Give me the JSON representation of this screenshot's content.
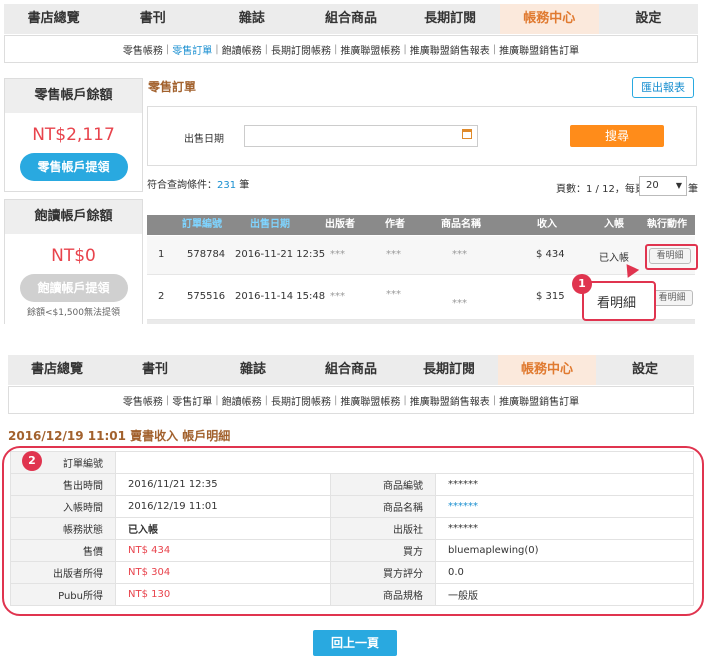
{
  "nav": [
    "書店總覽",
    "書刊",
    "雜誌",
    "組合商品",
    "長期訂閱",
    "帳務中心",
    "設定"
  ],
  "subnav": [
    "零售帳務",
    "零售訂單",
    "飽讀帳務",
    "長期訂閱帳務",
    "推廣聯盟帳務",
    "推廣聯盟銷售報表",
    "推廣聯盟銷售訂單"
  ],
  "retail_box": {
    "title": "零售帳戶餘額",
    "amount": "NT$2,117",
    "button": "零售帳戶提領"
  },
  "bao_box": {
    "title": "飽讀帳戶餘額",
    "amount": "NT$0",
    "button": "飽讀帳戶提領",
    "note": "餘額<$1,500無法提領"
  },
  "orders": {
    "title": "零售訂單",
    "export_button": "匯出報表",
    "date_label": "出售日期",
    "search_button": "搜尋",
    "match_prefix": "符合查詢條件：",
    "match_count": "231",
    "match_suffix": "筆",
    "page_info": "頁數：1 / 12，每頁",
    "per_page": "20",
    "per_page_suffix": "筆",
    "columns": [
      "訂單編號",
      "出售日期",
      "出版者",
      "作者",
      "商品名稱",
      "收入",
      "入帳",
      "執行動作"
    ],
    "rows": [
      {
        "no": "1",
        "order": "578784",
        "date": "2016-11-21 12:35",
        "publisher": "***",
        "author": "***",
        "product": "***",
        "income": "$ 434",
        "status": "已入帳",
        "action": "看明細"
      },
      {
        "no": "2",
        "order": "575516",
        "date": "2016-11-14 15:48",
        "publisher": "***",
        "author": "***",
        "product": "***",
        "income": "$ 315",
        "status": "",
        "action": "看明細"
      }
    ]
  },
  "callouts": {
    "one": "1",
    "one_label": "看明細",
    "two": "2"
  },
  "detail": {
    "title": "2016/12/19 11:01 賣書收入 帳戶明細",
    "rows": [
      {
        "l1": "訂單編號",
        "v1": "",
        "l2": "",
        "v2": ""
      },
      {
        "l1": "售出時間",
        "v1": "2016/11/21 12:35",
        "l2": "商品編號",
        "v2": "******"
      },
      {
        "l1": "入帳時間",
        "v1": "2016/12/19 11:01",
        "l2": "商品名稱",
        "v2": "******"
      },
      {
        "l1": "帳務狀態",
        "v1": "已入帳",
        "l2": "出版社",
        "v2": "******"
      },
      {
        "l1": "售價",
        "v1": "NT$ 434",
        "l2": "買方",
        "v2": "bluemaplewing(0)"
      },
      {
        "l1": "出版者所得",
        "v1": "NT$ 304",
        "l2": "買方評分",
        "v2": "0.0"
      },
      {
        "l1": "Pubu所得",
        "v1": "NT$ 130",
        "l2": "商品規格",
        "v2": "一般版"
      }
    ],
    "back_button": "回上一頁"
  },
  "colors": {
    "accent": "#29a9e0",
    "active_nav": "#e07a30",
    "callout": "#e0344f",
    "amount": "#e8434c"
  }
}
